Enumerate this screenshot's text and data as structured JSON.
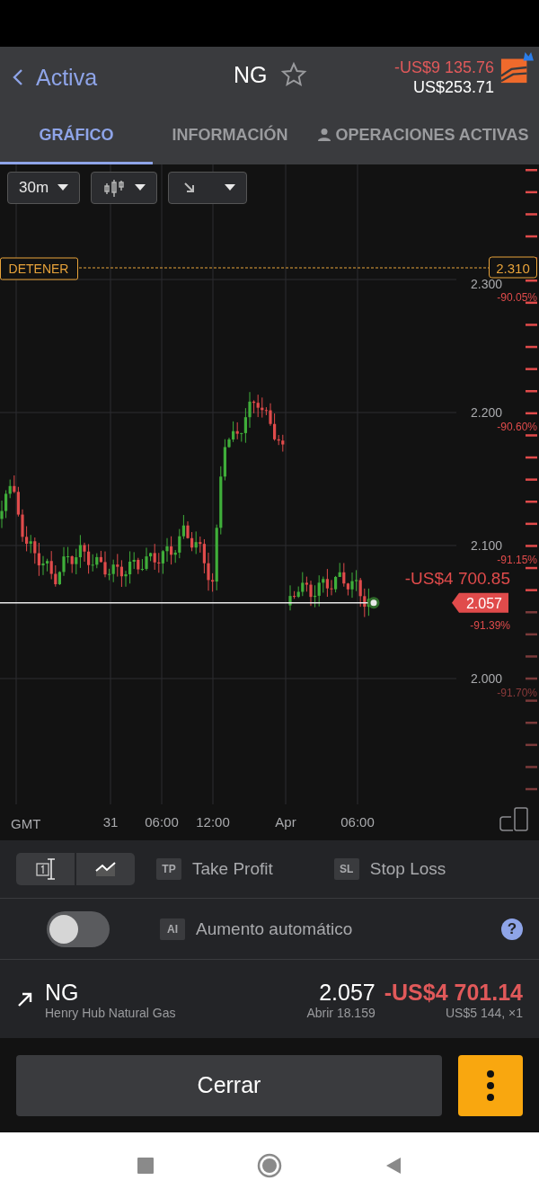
{
  "header": {
    "back_label": "Activa",
    "symbol": "NG",
    "favorite": false,
    "pnl": "-US$9 135.76",
    "balance": "US$253.71"
  },
  "tabs": [
    {
      "label": "GRÁFICO",
      "selected": true,
      "kind": "text"
    },
    {
      "label": "INFORMACIÓN",
      "selected": false,
      "kind": "text"
    },
    {
      "label": "OPERACIONES ACTIVAS",
      "selected": false,
      "kind": "person"
    }
  ],
  "chart_toolbar": {
    "timeframe": "30m"
  },
  "chart": {
    "stop_label": "DETENER",
    "stop_value": "2.310",
    "y_labels": [
      {
        "value": "2.300",
        "percent": "-90.05%"
      },
      {
        "value": "2.200",
        "percent": "-90.60%"
      },
      {
        "value": "2.100",
        "percent": "-91.15%"
      },
      {
        "value": "2.000",
        "percent": "-91.70%"
      }
    ],
    "current_value": "2.057",
    "current_pnl": "-US$4 700.85",
    "current_percent": "-91.39%",
    "timezone": "GMT",
    "x_labels": [
      "31",
      "06:00",
      "12:00",
      "Apr",
      "06:00"
    ]
  },
  "tools": {
    "tp_badge": "TP",
    "take_profit": "Take Profit",
    "sl_badge": "SL",
    "stop_loss": "Stop Loss"
  },
  "auto_increase": {
    "on": false,
    "badge": "AI",
    "label": "Aumento automático",
    "help": "?"
  },
  "position": {
    "symbol": "NG",
    "name": "Henry Hub Natural Gas",
    "price": "2.057",
    "open": "Abrir 18.159",
    "pnl": "-US$4 701.14",
    "size": "US$5 144, ×1"
  },
  "close_button": "Cerrar"
}
